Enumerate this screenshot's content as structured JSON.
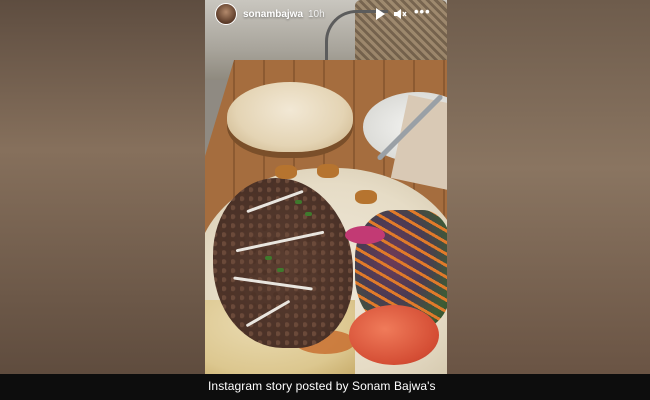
{
  "story": {
    "username": "sonambajwa",
    "time": "10h",
    "controls": {
      "play_icon": "play-icon",
      "sound_icon": "speaker-icon",
      "more_icon": "more-horizontal-icon"
    }
  },
  "caption": {
    "text": "Instagram story posted by  Sonam Bajwa's"
  },
  "colors": {
    "caption_bar": "#0d0d0d",
    "header_text": "#ffffff"
  }
}
